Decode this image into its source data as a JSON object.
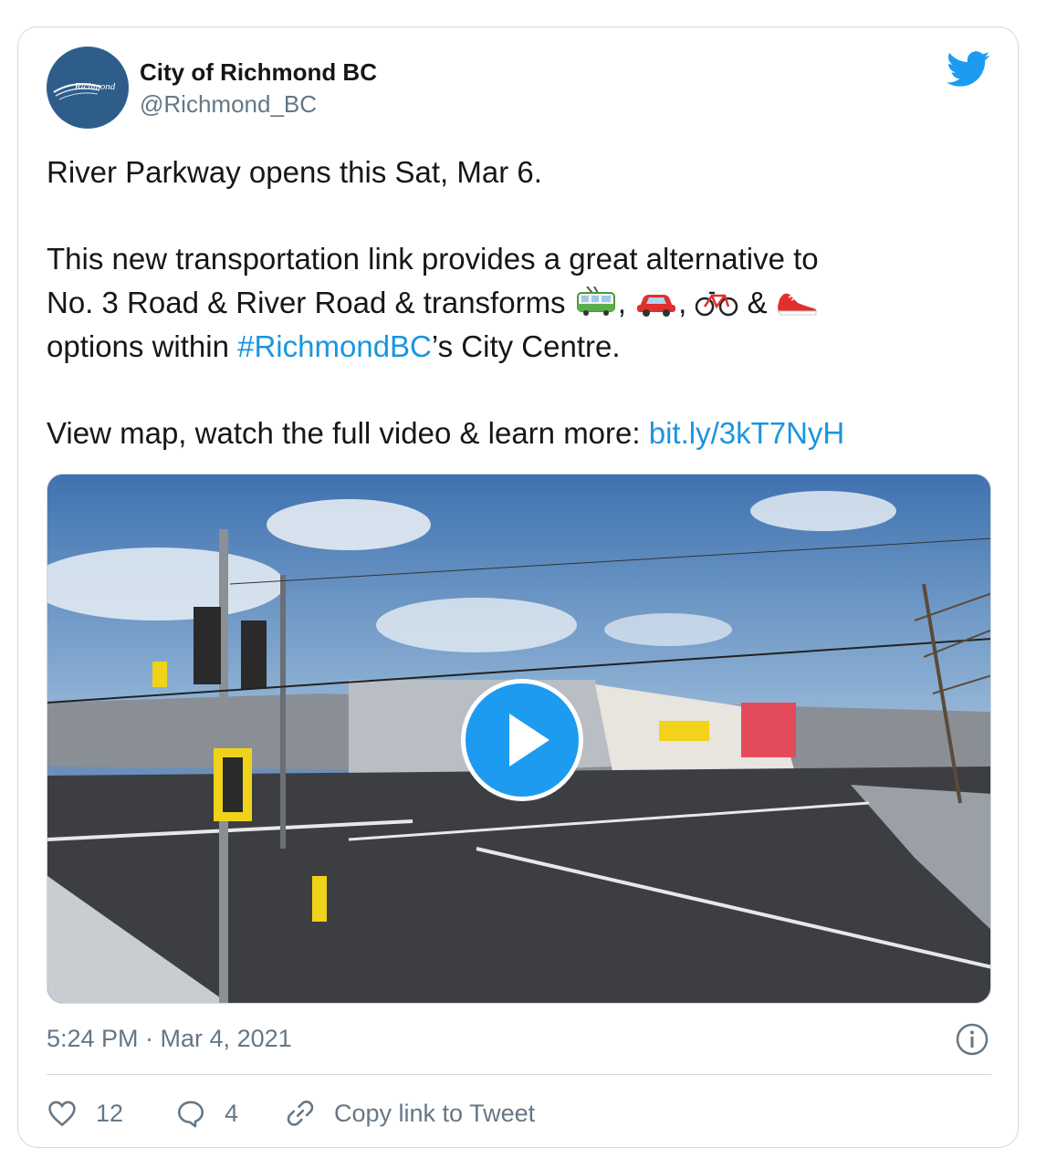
{
  "author": {
    "name": "City of Richmond BC",
    "handle": "@Richmond_BC",
    "avatar_text": "Richmond"
  },
  "tweet": {
    "line1": "River Parkway opens this Sat, Mar 6.",
    "line2": "This new transportation link provides a great alternative to",
    "line3_a": "No. 3 Road & River Road & transforms",
    "line3_sep1": ",",
    "line3_sep2": ",",
    "line3_amp": "&",
    "line4_a": "options within ",
    "hashtag": "#RichmondBC",
    "line4_b": "’s City Centre.",
    "line5_a": "View map, watch the full video & learn more: ",
    "url": "bit.ly/3kT7NyH",
    "emojis": [
      "trolleybus-emoji",
      "car-emoji",
      "bicycle-emoji",
      "running-shoe-emoji"
    ]
  },
  "media": {
    "type": "video",
    "play_icon": "play-icon"
  },
  "meta": {
    "timestamp": "5:24 PM · Mar 4, 2021"
  },
  "actions": {
    "likes": "12",
    "replies": "4",
    "copy_link": "Copy link to Tweet"
  },
  "colors": {
    "link": "#1b95e0",
    "twitter_blue": "#1d9bf0",
    "muted": "#657786",
    "border": "#cfd9de"
  }
}
